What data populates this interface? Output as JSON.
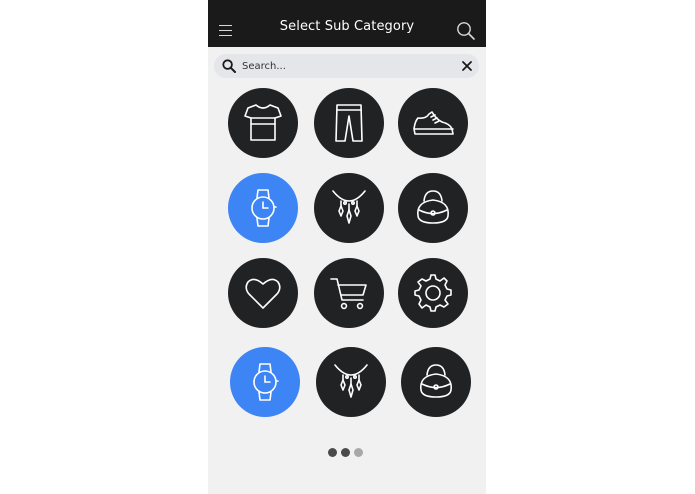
{
  "header": {
    "title": "Select Sub Category",
    "menu_icon": "hamburger-menu-icon",
    "search_icon": "search-icon"
  },
  "search": {
    "placeholder": "Search...",
    "value": "",
    "clear_icon": "close-icon"
  },
  "categories": [
    {
      "icon": "tshirt-icon",
      "selected": false
    },
    {
      "icon": "pants-icon",
      "selected": false
    },
    {
      "icon": "sneaker-icon",
      "selected": false
    },
    {
      "icon": "watch-icon",
      "selected": true
    },
    {
      "icon": "necklace-icon",
      "selected": false
    },
    {
      "icon": "handbag-icon",
      "selected": false
    },
    {
      "icon": "heart-icon",
      "selected": false
    },
    {
      "icon": "shopping-cart-icon",
      "selected": false
    },
    {
      "icon": "gear-icon",
      "selected": false
    },
    {
      "icon": "watch-icon",
      "selected": true
    },
    {
      "icon": "necklace-icon",
      "selected": false
    },
    {
      "icon": "handbag-icon",
      "selected": false
    }
  ],
  "pagination": {
    "pages": 3,
    "current": 2
  },
  "colors": {
    "appbar": "#1a1a1a",
    "circle": "#202224",
    "selected": "#3d84f5",
    "background": "#f1f1f1",
    "dot_active": "#4a4a4a",
    "dot_inactive": "#a8a8a8"
  }
}
